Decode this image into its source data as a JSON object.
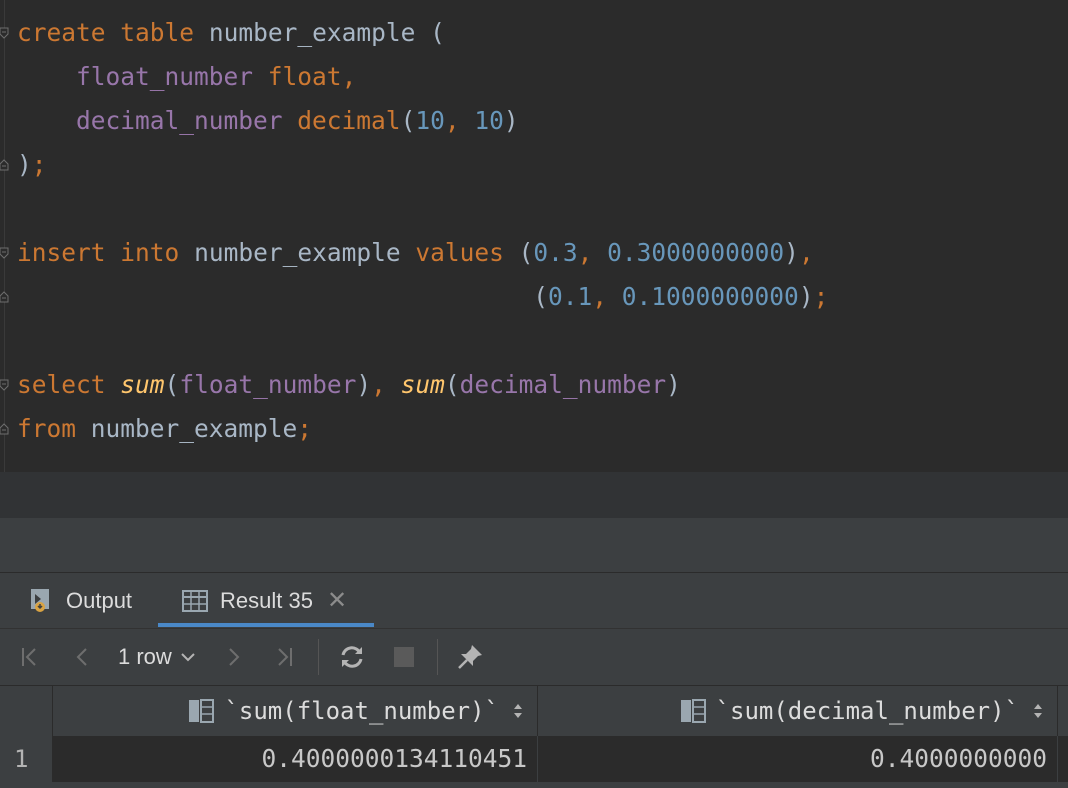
{
  "editor": {
    "lines": [
      [
        {
          "t": "create",
          "c": "kw"
        },
        {
          "t": " "
        },
        {
          "t": "table",
          "c": "kw"
        },
        {
          "t": " "
        },
        {
          "t": "number_example",
          "c": "id"
        },
        {
          "t": " ("
        }
      ],
      [
        {
          "t": "    "
        },
        {
          "t": "float_number",
          "c": "col"
        },
        {
          "t": " "
        },
        {
          "t": "float",
          "c": "kw"
        },
        {
          "t": ",",
          "c": "pc"
        }
      ],
      [
        {
          "t": "    "
        },
        {
          "t": "decimal_number",
          "c": "col"
        },
        {
          "t": " "
        },
        {
          "t": "decimal",
          "c": "kw"
        },
        {
          "t": "("
        },
        {
          "t": "10",
          "c": "num"
        },
        {
          "t": ", ",
          "c": "pc"
        },
        {
          "t": "10",
          "c": "num"
        },
        {
          "t": ")"
        }
      ],
      [
        {
          "t": ")"
        },
        {
          "t": ";",
          "c": "pc"
        }
      ],
      [],
      [
        {
          "t": "insert",
          "c": "kw"
        },
        {
          "t": " "
        },
        {
          "t": "into",
          "c": "kw"
        },
        {
          "t": " "
        },
        {
          "t": "number_example",
          "c": "id"
        },
        {
          "t": " "
        },
        {
          "t": "values",
          "c": "kw"
        },
        {
          "t": " ("
        },
        {
          "t": "0.3",
          "c": "num"
        },
        {
          "t": ", ",
          "c": "pc"
        },
        {
          "t": "0.3000000000",
          "c": "num"
        },
        {
          "t": ")"
        },
        {
          "t": ",",
          "c": "pc"
        }
      ],
      [
        {
          "t": "                                   ("
        },
        {
          "t": "0.1",
          "c": "num"
        },
        {
          "t": ", ",
          "c": "pc"
        },
        {
          "t": "0.1000000000",
          "c": "num"
        },
        {
          "t": ")"
        },
        {
          "t": ";",
          "c": "pc"
        }
      ],
      [],
      [
        {
          "t": "select",
          "c": "kw"
        },
        {
          "t": " "
        },
        {
          "t": "sum",
          "c": "fn"
        },
        {
          "t": "("
        },
        {
          "t": "float_number",
          "c": "col"
        },
        {
          "t": ")"
        },
        {
          "t": ", ",
          "c": "pc"
        },
        {
          "t": "sum",
          "c": "fn"
        },
        {
          "t": "("
        },
        {
          "t": "decimal_number",
          "c": "col"
        },
        {
          "t": ")"
        }
      ],
      [
        {
          "t": "from",
          "c": "kw"
        },
        {
          "t": " "
        },
        {
          "t": "number_example",
          "c": "id"
        },
        {
          "t": ";",
          "c": "pc"
        }
      ]
    ]
  },
  "tabs": {
    "output_label": "Output",
    "result_label": "Result 35",
    "close_glyph": "✕"
  },
  "toolbar": {
    "rows_label": "1 row"
  },
  "grid": {
    "columns": [
      "`sum(float_number)`",
      "`sum(decimal_number)`"
    ],
    "rows": [
      {
        "num": "1",
        "values": [
          "0.4000000134110451",
          "0.4000000000"
        ]
      }
    ]
  },
  "colors": {
    "keyword": "#cc7832",
    "identifier": "#a9b7c6",
    "column": "#9876aa",
    "number": "#6897bb",
    "function": "#ffc66d",
    "accent": "#4a88c7"
  }
}
